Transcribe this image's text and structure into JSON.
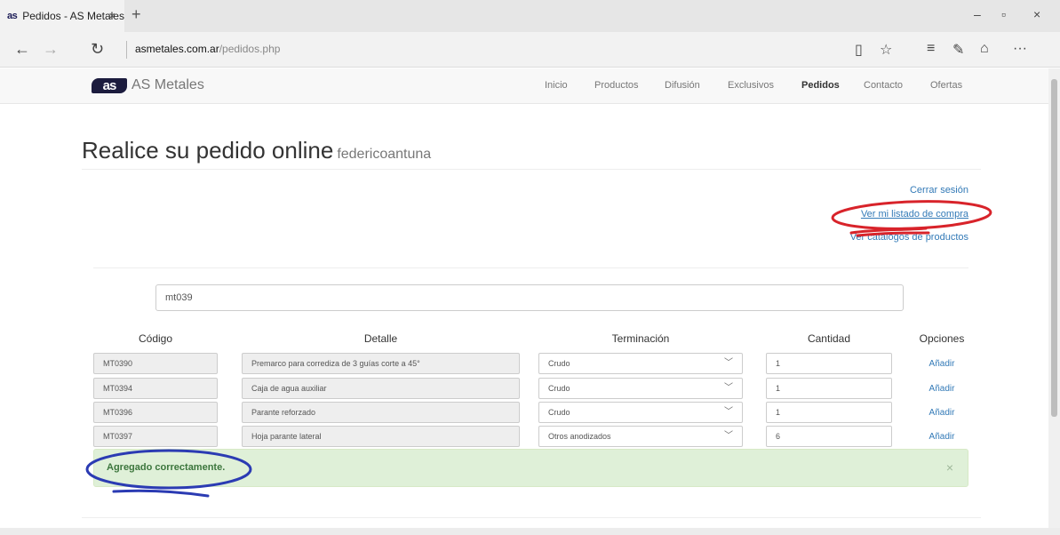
{
  "browser": {
    "tab_favicon": "as",
    "tab_title": "Pedidos - AS Metales",
    "tab_close": "×",
    "new_tab": "+",
    "url_host": "asmetales.com.ar",
    "url_path": "/pedidos.php",
    "window_controls": {
      "minimize": "–",
      "restore": "▫",
      "close": "×"
    },
    "nav": {
      "back": "←",
      "forward": "→",
      "refresh": "↻"
    },
    "tools": {
      "reading_view": "▯",
      "favorite": "☆",
      "hub": "≡",
      "notes": "✎",
      "share": "⌂",
      "more": "···"
    }
  },
  "site": {
    "logo_text": "as",
    "brand_name": "AS Metales",
    "menu": [
      {
        "label": "Inicio",
        "active": false
      },
      {
        "label": "Productos",
        "active": false
      },
      {
        "label": "Difusión",
        "active": false
      },
      {
        "label": "Exclusivos",
        "active": false
      },
      {
        "label": "Pedidos",
        "active": true
      },
      {
        "label": "Contacto",
        "active": false
      },
      {
        "label": "Ofertas",
        "active": false
      }
    ]
  },
  "page": {
    "title": "Realice su pedido online",
    "username": "federicoantuna",
    "links": {
      "logout": "Cerrar sesión",
      "view_list": "Ver mi listado de compra",
      "catalogs": "Ver catálogos de productos"
    },
    "search_value": "mt039",
    "table": {
      "headers": {
        "code": "Código",
        "detail": "Detalle",
        "finish": "Terminación",
        "quantity": "Cantidad",
        "options": "Opciones"
      },
      "rows": [
        {
          "code": "MT0390",
          "detail": "Premarco para corrediza de 3 guías corte a 45°",
          "finish": "Crudo",
          "quantity": "1",
          "action": "Añadir"
        },
        {
          "code": "MT0394",
          "detail": "Caja de agua auxiliar",
          "finish": "Crudo",
          "quantity": "1",
          "action": "Añadir"
        },
        {
          "code": "MT0396",
          "detail": "Parante reforzado",
          "finish": "Crudo",
          "quantity": "1",
          "action": "Añadir"
        },
        {
          "code": "MT0397",
          "detail": "Hoja parante lateral",
          "finish": "Otros anodizados",
          "quantity": "6",
          "action": "Añadir"
        }
      ]
    },
    "alert": {
      "message": "Agregado correctamente.",
      "close": "×"
    }
  },
  "colors": {
    "link": "#337ab7",
    "alert_bg": "#dff0d8",
    "alert_text": "#3c763d",
    "annotation_red": "#d8232a",
    "annotation_blue": "#2b3bb3"
  }
}
